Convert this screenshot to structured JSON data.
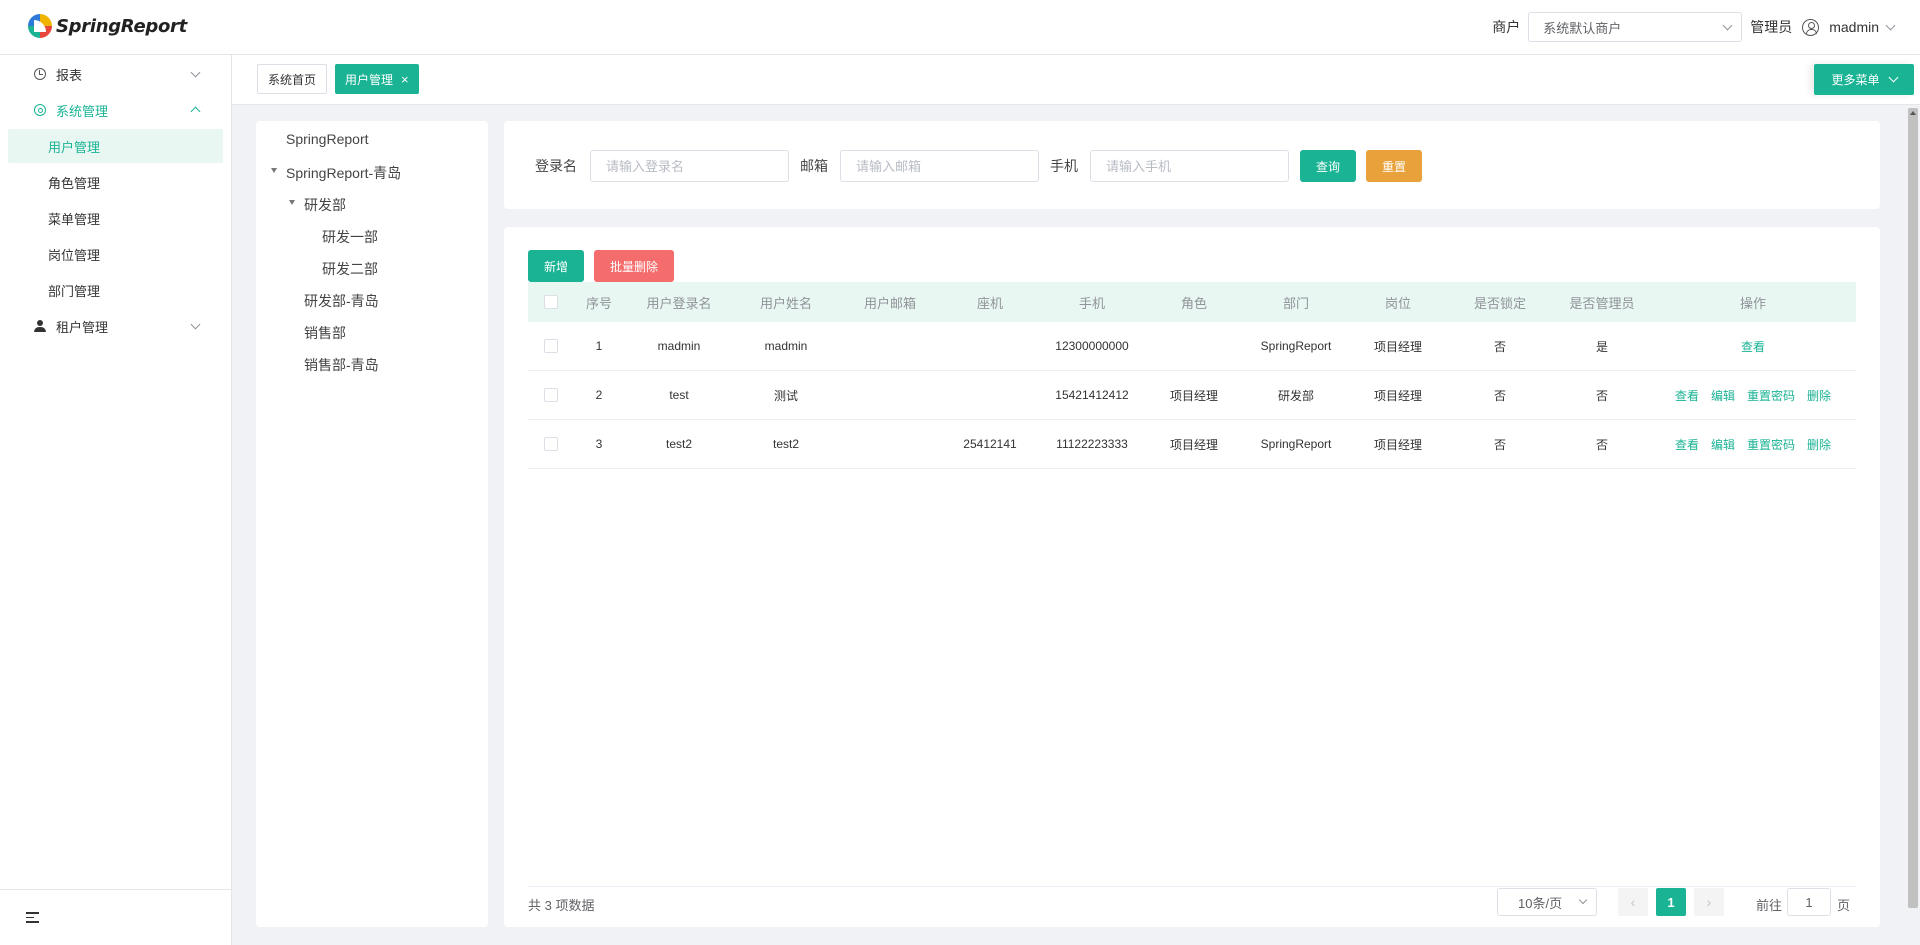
{
  "app": {
    "brand": "SpringReport"
  },
  "header": {
    "tenant_label": "商户",
    "tenant_value": "系统默认商户",
    "role_label": "管理员",
    "username": "madmin"
  },
  "sidebar": {
    "items": [
      {
        "label": "报表"
      },
      {
        "label": "系统管理"
      },
      {
        "label": "用户管理"
      },
      {
        "label": "角色管理"
      },
      {
        "label": "菜单管理"
      },
      {
        "label": "岗位管理"
      },
      {
        "label": "部门管理"
      },
      {
        "label": "租户管理"
      }
    ]
  },
  "tabs": {
    "home": "系统首页",
    "active": "用户管理",
    "close": "×",
    "more": "更多菜单"
  },
  "tree": {
    "nodes": [
      "SpringReport",
      "SpringReport-青岛",
      "研发部",
      "研发一部",
      "研发二部",
      "研发部-青岛",
      "销售部",
      "销售部-青岛"
    ]
  },
  "search": {
    "login_label": "登录名",
    "login_placeholder": "请输入登录名",
    "email_label": "邮箱",
    "email_placeholder": "请输入邮箱",
    "phone_label": "手机",
    "phone_placeholder": "请输入手机",
    "query": "查询",
    "reset": "重置"
  },
  "toolbar": {
    "add": "新增",
    "batch_delete": "批量删除"
  },
  "table": {
    "columns": [
      "序号",
      "用户登录名",
      "用户姓名",
      "用户邮箱",
      "座机",
      "手机",
      "角色",
      "部门",
      "岗位",
      "是否锁定",
      "是否管理员",
      "操作"
    ],
    "rows": [
      {
        "no": "1",
        "login": "madmin",
        "name": "madmin",
        "email": "",
        "tel": "",
        "mobile": "12300000000",
        "role": "",
        "dept": "SpringReport",
        "post": "项目经理",
        "locked": "否",
        "admin": "是",
        "ops": [
          "查看"
        ]
      },
      {
        "no": "2",
        "login": "test",
        "name": "测试",
        "email": "",
        "tel": "",
        "mobile": "15421412412",
        "role": "项目经理",
        "dept": "研发部",
        "post": "项目经理",
        "locked": "否",
        "admin": "否",
        "ops": [
          "查看",
          "编辑",
          "重置密码",
          "删除"
        ]
      },
      {
        "no": "3",
        "login": "test2",
        "name": "test2",
        "email": "",
        "tel": "25412141",
        "mobile": "11122223333",
        "role": "项目经理",
        "dept": "SpringReport",
        "post": "项目经理",
        "locked": "否",
        "admin": "否",
        "ops": [
          "查看",
          "编辑",
          "重置密码",
          "删除"
        ]
      }
    ]
  },
  "pagination": {
    "total": "共 3 项数据",
    "page_size": "10条/页",
    "prev": "‹",
    "current": "1",
    "next": "›",
    "goto_label": "前往",
    "goto_value": "1",
    "page_unit": "页"
  },
  "colors": {
    "primary": "#1ab394",
    "warn": "#e9a23b",
    "danger": "#f56c6c"
  }
}
